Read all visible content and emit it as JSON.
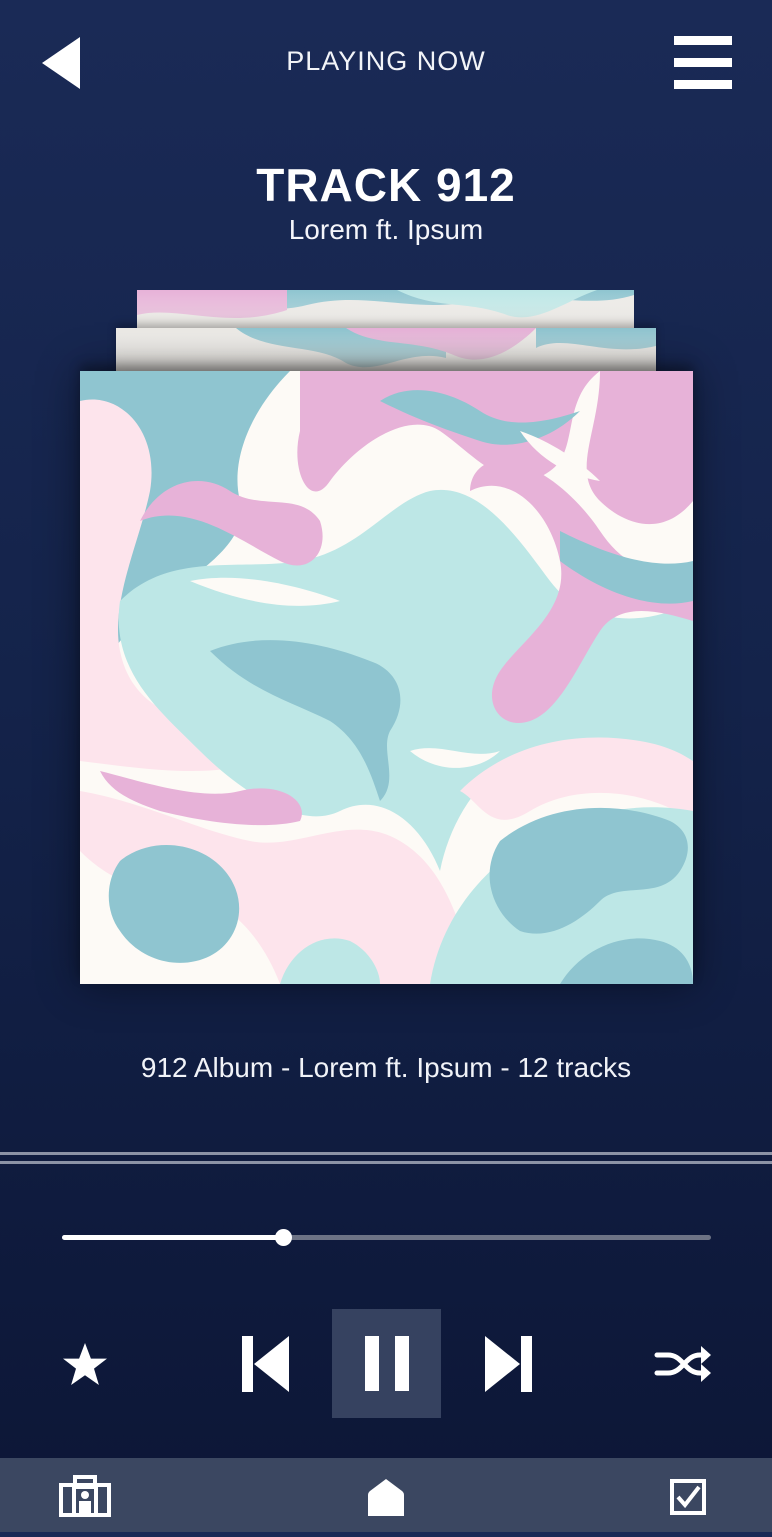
{
  "header": {
    "title": "PLAYING NOW",
    "back_icon": "back-triangle-icon",
    "menu_icon": "hamburger-menu-icon"
  },
  "track": {
    "title": "TRACK 912",
    "artist": "Lorem ft. Ipsum"
  },
  "album": {
    "info": "912 Album - Lorem ft. Ipsum - 12 tracks"
  },
  "player": {
    "progress": 0.34,
    "controls": [
      "star-icon",
      "skip-previous-icon",
      "pause-icon",
      "skip-next-icon",
      "shuffle-icon"
    ]
  },
  "bottom_nav": {
    "items": [
      "library-icon",
      "home-icon",
      "checkbox-icon"
    ]
  },
  "colors": {
    "background": "#14234a",
    "nav_bar": "#3b4761",
    "pause_button": "#364260",
    "art_pink": "#e7b2d8",
    "art_teal": "#8fc5d0",
    "art_mint": "#bde7e6",
    "art_blush": "#fde4ec",
    "art_cream": "#fdfaf6"
  }
}
